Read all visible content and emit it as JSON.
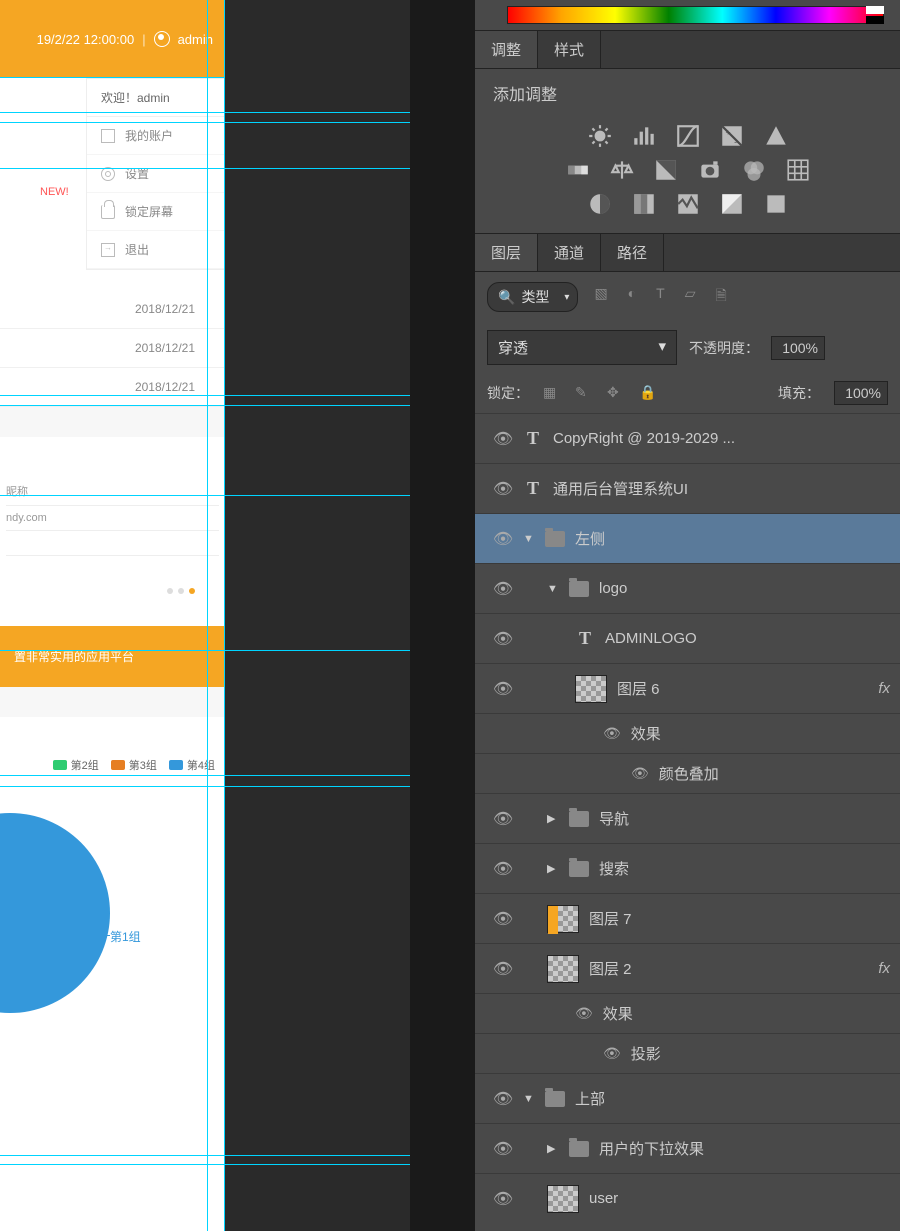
{
  "mockup": {
    "header": {
      "datetime": "19/2/22 12:00:00",
      "separator": "|",
      "user": "admin"
    },
    "dropdown": {
      "title": "欢迎！admin",
      "items": [
        {
          "label": "我的账户"
        },
        {
          "label": "设置"
        },
        {
          "label": "锁定屏幕"
        },
        {
          "label": "退出"
        }
      ]
    },
    "new_badge": "NEW!",
    "dates": [
      "2018/12/21",
      "2018/12/21",
      "2018/12/21"
    ],
    "inputs": {
      "line1": "昵称",
      "line2": "ndy.com"
    },
    "banner": "置非常实用的应用平台",
    "chart": {
      "legend": [
        {
          "label": "第2组",
          "color": "#2ecc71"
        },
        {
          "label": "第3组",
          "color": "#e67e22"
        },
        {
          "label": "第4组",
          "color": "#3498db"
        }
      ],
      "slice_label": "第1组"
    }
  },
  "ps": {
    "adjustments_tabs": [
      "调整",
      "样式"
    ],
    "adjustments_title": "添加调整",
    "layers_tabs": [
      "图层",
      "通道",
      "路径"
    ],
    "filter_label": "类型",
    "blend_mode": "穿透",
    "opacity_label": "不透明度：",
    "opacity_value": "100%",
    "lock_label": "锁定：",
    "fill_label": "填充：",
    "fill_value": "100%",
    "layers": [
      {
        "name": "CopyRight @ 2019-2029 ...",
        "kind": "text",
        "indent": 0
      },
      {
        "name": "通用后台管理系统UI",
        "kind": "text",
        "indent": 0
      },
      {
        "name": "左侧",
        "kind": "folder",
        "indent": 0,
        "open": true,
        "selected": true
      },
      {
        "name": "logo",
        "kind": "folder",
        "indent": 1,
        "open": true
      },
      {
        "name": "ADMINLOGO",
        "kind": "text",
        "indent": 2
      },
      {
        "name": "图层 6",
        "kind": "thumb",
        "indent": 2,
        "fx": true
      },
      {
        "name": "效果",
        "kind": "effect",
        "indent": 3
      },
      {
        "name": "颜色叠加",
        "kind": "effect",
        "indent": 4
      },
      {
        "name": "导航",
        "kind": "folder",
        "indent": 1,
        "open": false
      },
      {
        "name": "搜索",
        "kind": "folder",
        "indent": 1,
        "open": false
      },
      {
        "name": "图层 7",
        "kind": "thumb-orange",
        "indent": 1
      },
      {
        "name": "图层 2",
        "kind": "thumb",
        "indent": 1,
        "fx": true
      },
      {
        "name": "效果",
        "kind": "effect",
        "indent": 2
      },
      {
        "name": "投影",
        "kind": "effect",
        "indent": 3
      },
      {
        "name": "上部",
        "kind": "folder",
        "indent": 0,
        "open": true
      },
      {
        "name": "用户的下拉效果",
        "kind": "folder",
        "indent": 1,
        "open": false
      },
      {
        "name": "user",
        "kind": "thumb",
        "indent": 1
      }
    ]
  }
}
